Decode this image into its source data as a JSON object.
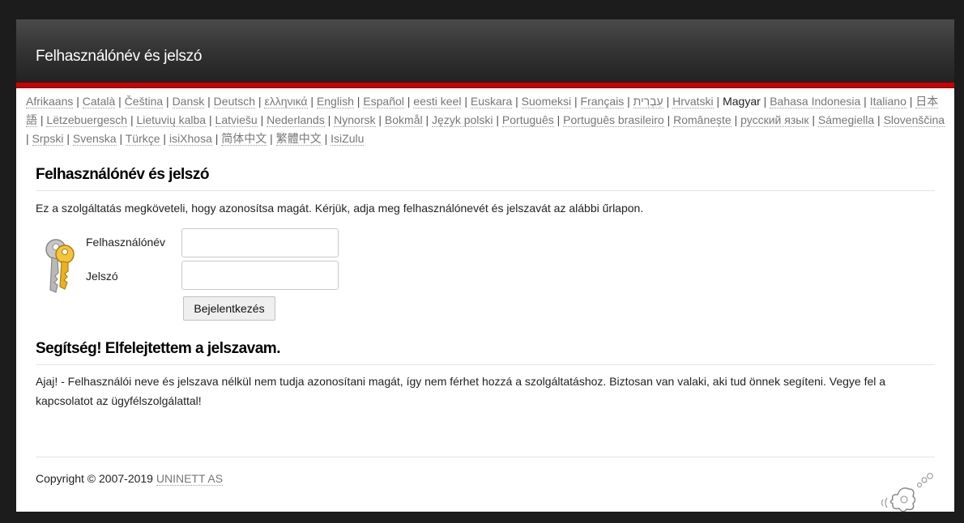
{
  "header": {
    "title": "Felhasználónév és jelszó"
  },
  "languages": [
    {
      "label": "Afrikaans",
      "current": false
    },
    {
      "label": "Català",
      "current": false
    },
    {
      "label": "Čeština",
      "current": false
    },
    {
      "label": "Dansk",
      "current": false
    },
    {
      "label": "Deutsch",
      "current": false
    },
    {
      "label": "ελληνικά",
      "current": false
    },
    {
      "label": "English",
      "current": false
    },
    {
      "label": "Español",
      "current": false
    },
    {
      "label": "eesti keel",
      "current": false
    },
    {
      "label": "Euskara",
      "current": false
    },
    {
      "label": "Suomeksi",
      "current": false
    },
    {
      "label": "Français",
      "current": false
    },
    {
      "label": "עִבְרִית",
      "current": false
    },
    {
      "label": "Hrvatski",
      "current": false
    },
    {
      "label": "Magyar",
      "current": true
    },
    {
      "label": "Bahasa Indonesia",
      "current": false
    },
    {
      "label": "Italiano",
      "current": false
    },
    {
      "label": "日本語",
      "current": false
    },
    {
      "label": "Lëtzebuergesch",
      "current": false
    },
    {
      "label": "Lietuvių kalba",
      "current": false
    },
    {
      "label": "Latviešu",
      "current": false
    },
    {
      "label": "Nederlands",
      "current": false
    },
    {
      "label": "Nynorsk",
      "current": false
    },
    {
      "label": "Bokmål",
      "current": false
    },
    {
      "label": "Język polski",
      "current": false
    },
    {
      "label": "Português",
      "current": false
    },
    {
      "label": "Português brasileiro",
      "current": false
    },
    {
      "label": "Românește",
      "current": false
    },
    {
      "label": "русский язык",
      "current": false
    },
    {
      "label": "Sámegiella",
      "current": false
    },
    {
      "label": "Slovenščina",
      "current": false
    },
    {
      "label": "Srpski",
      "current": false
    },
    {
      "label": "Svenska",
      "current": false
    },
    {
      "label": "Türkçe",
      "current": false
    },
    {
      "label": "isiXhosa",
      "current": false
    },
    {
      "label": "简体中文",
      "current": false
    },
    {
      "label": "繁體中文",
      "current": false
    },
    {
      "label": "IsiZulu",
      "current": false
    }
  ],
  "main": {
    "heading": "Felhasználónév és jelszó",
    "description": "Ez a szolgáltatás megköveteli, hogy azonosítsa magát. Kérjük, adja meg felhasználónevét és jelszavát az alábbi űrlapon."
  },
  "form": {
    "username_label": "Felhasználónév",
    "username_value": "",
    "password_label": "Jelszó",
    "password_value": "",
    "submit_label": "Bejelentkezés"
  },
  "help": {
    "heading": "Segítség! Elfelejtettem a jelszavam.",
    "text": "Ajaj! - Felhasználói neve és jelszava nélkül nem tudja azonosítani magát, így nem férhet hozzá a szolgáltatáshoz. Biztosan van valaki, aki tud önnek segíteni. Vegye fel a kapcsolatot az ügyfélszolgálattal!"
  },
  "footer": {
    "copyright": "Copyright © 2007-2019 ",
    "company": "UNINETT AS"
  },
  "icons": {
    "keys": "keys-icon",
    "logo": "simplesamlphp-logo"
  },
  "colors": {
    "accent": "#cc0000",
    "header_bg": "#2a2a2a"
  }
}
